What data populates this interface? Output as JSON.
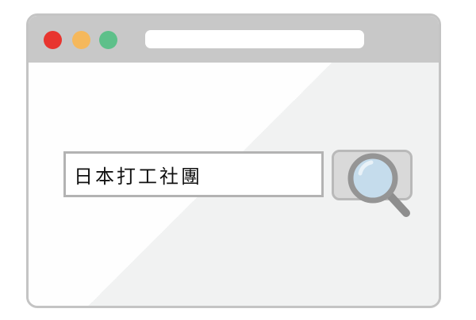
{
  "window": {
    "dots": [
      {
        "name": "close",
        "color": "#e8352f"
      },
      {
        "name": "minimize",
        "color": "#f5b85c"
      },
      {
        "name": "zoom",
        "color": "#5ec08a"
      }
    ],
    "address_bar": {
      "value": ""
    }
  },
  "search": {
    "query": "日本打工社團",
    "button_icon": "magnifier-icon"
  },
  "colors": {
    "frame": "#c4c4c4",
    "titlebar": "#c8c8c8",
    "lens": "#c5dcec"
  }
}
